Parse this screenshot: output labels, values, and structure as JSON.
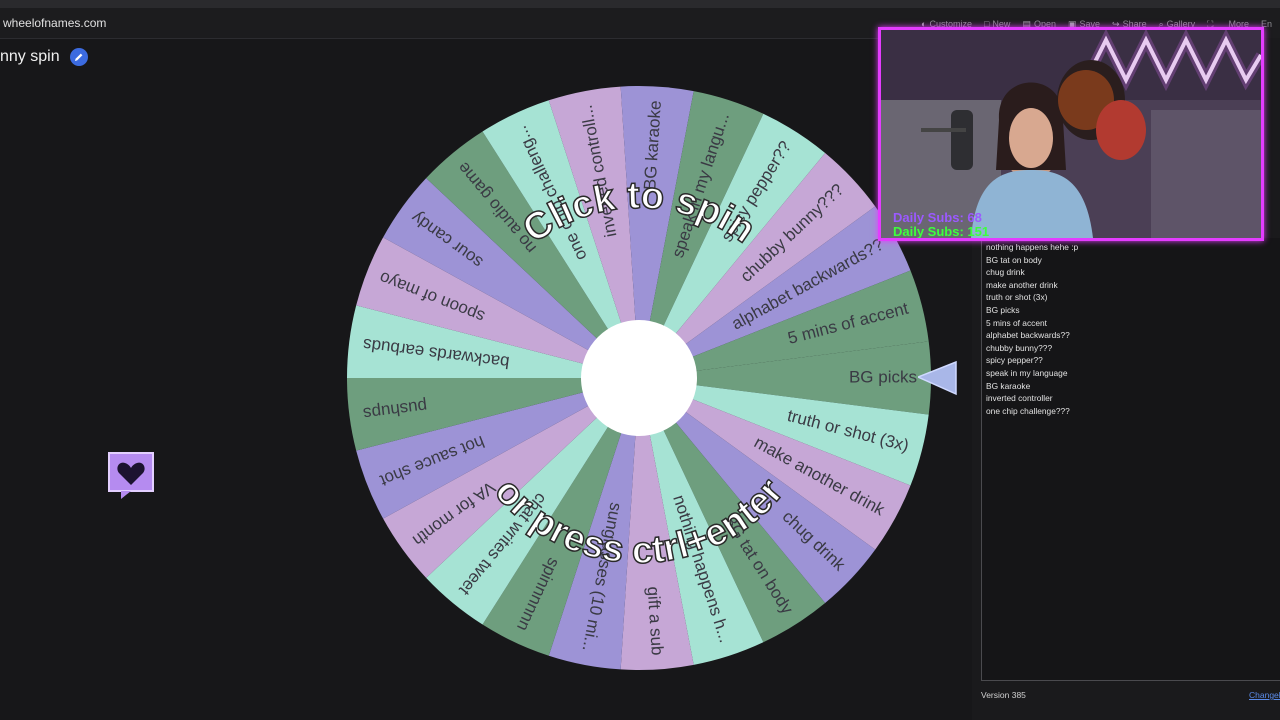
{
  "browser": {
    "url": "wheelofnames.com"
  },
  "toolbar": {
    "items": [
      {
        "icon": "palette-icon",
        "label": "Customize"
      },
      {
        "icon": "new-icon",
        "label": "New"
      },
      {
        "icon": "folder-icon",
        "label": "Open"
      },
      {
        "icon": "save-icon",
        "label": "Save"
      },
      {
        "icon": "share-icon",
        "label": "Share"
      },
      {
        "icon": "gallery-icon",
        "label": "Gallery"
      },
      {
        "icon": "fullscreen-icon",
        "label": ""
      },
      {
        "icon": "",
        "label": "More"
      },
      {
        "icon": "",
        "label": "En"
      }
    ]
  },
  "wheel": {
    "title": "nny spin",
    "prompt_top": "Click to spin",
    "prompt_bottom": "or press ctrl+enter",
    "colors": [
      "#6e9e7e",
      "#a6e3d4",
      "#c6a7d6",
      "#9d93d6"
    ],
    "segments": [
      "BG picks",
      "truth or shot (3x)",
      "make another drink",
      "chug drink",
      "BG tat on body",
      "nothing happens h...",
      "gift a sub",
      "sunglasses (10 mi...",
      "spinnnnnn",
      "chat writes tweet",
      "VA for month",
      "hot sauce shot",
      "pushups",
      "backwards earbuds",
      "spoon of mayo",
      "sour candy",
      "no audio game",
      "one chip challeng...",
      "inverted controll...",
      "BG karaoke",
      "speak in my langu...",
      "spicy pepper??",
      "chubby bunny???",
      "alphabet backwards??",
      "5 mins of accent"
    ]
  },
  "entries": [
    "nothing happens hehe :p",
    "BG tat on body",
    "chug drink",
    "make another drink",
    "truth or shot (3x)",
    "BG picks",
    "5 mins of accent",
    "alphabet backwards??",
    "chubby bunny???",
    "spicy pepper??",
    "speak in my language",
    "BG karaoke",
    "inverted controller",
    "one chip challenge???"
  ],
  "footer": {
    "version": "Version 385",
    "changelog": "Changel"
  },
  "stream_overlay": {
    "subs_line1": "Daily Subs: 68",
    "subs_line2": "Daily Subs: 151",
    "border_color": "#e43cff"
  }
}
